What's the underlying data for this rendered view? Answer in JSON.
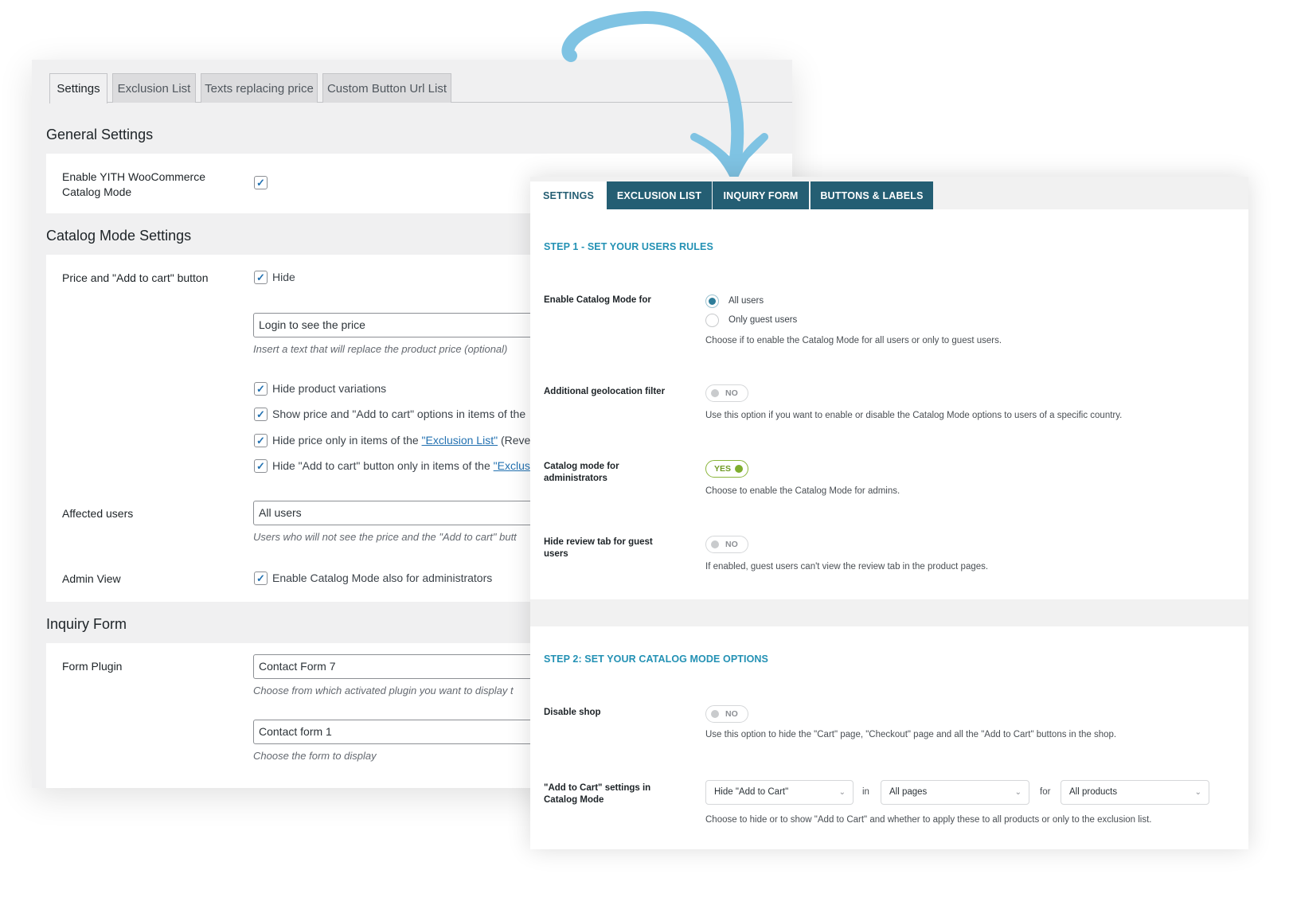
{
  "old_panel": {
    "tabs": [
      "Settings",
      "Exclusion List",
      "Texts replacing price",
      "Custom Button Url List"
    ],
    "general": {
      "title": "General Settings",
      "enable_label": "Enable YITH WooCommerce Catalog Mode"
    },
    "catalog": {
      "title": "Catalog Mode Settings",
      "price_label": "Price and \"Add to cart\" button",
      "hide_label": "Hide",
      "price_text_value": "Login to see the price",
      "price_text_desc": "Insert a text that will replace the product price (optional)",
      "hide_variations": "Hide product variations",
      "show_price_text": "Show price and \"Add to cart\" options in items of the",
      "hide_price_only_pre": "Hide price only in items of the ",
      "hide_price_only_link": "\"Exclusion List\"",
      "hide_price_only_post": " (Rever",
      "hide_cart_only_pre": "Hide \"Add to cart\" button only in items of the ",
      "hide_cart_only_link": "\"Exclus",
      "affected_label": "Affected users",
      "affected_value": "All users",
      "affected_desc": "Users who will not see the price and the \"Add to cart\" butt",
      "admin_label": "Admin View",
      "admin_checkbox": "Enable Catalog Mode also for administrators"
    },
    "inquiry": {
      "title": "Inquiry Form",
      "plugin_label": "Form Plugin",
      "plugin_value": "Contact Form 7",
      "plugin_desc": "Choose from which activated plugin you want to display t",
      "form_value": "Contact form 1",
      "form_desc": "Choose the form to display"
    }
  },
  "new_panel": {
    "tabs": [
      "SETTINGS",
      "EXCLUSION LIST",
      "INQUIRY FORM",
      "BUTTONS & LABELS"
    ],
    "step1": {
      "title": "STEP 1 - SET YOUR USERS RULES",
      "enable_for_label": "Enable Catalog Mode for",
      "radio_all": "All users",
      "radio_guest": "Only guest users",
      "enable_for_desc": "Choose if to enable the Catalog Mode for all users or only to guest users.",
      "geo_label": "Additional geolocation filter",
      "geo_toggle": "NO",
      "geo_desc": "Use this option if you want to enable or disable the Catalog Mode options to users of a specific country.",
      "admins_label": "Catalog mode for administrators",
      "admins_toggle": "YES",
      "admins_desc": "Choose to enable the Catalog Mode for admins.",
      "review_label": "Hide review tab for guest users",
      "review_toggle": "NO",
      "review_desc": "If enabled, guest users can't view the review tab in the product pages."
    },
    "step2": {
      "title": "STEP 2: SET YOUR CATALOG MODE OPTIONS",
      "disable_shop_label": "Disable shop",
      "disable_shop_toggle": "NO",
      "disable_shop_desc": "Use this option to hide the \"Cart\" page, \"Checkout\" page and all the \"Add to Cart\" buttons in the shop.",
      "atc_label": "\"Add to Cart\" settings in Catalog Mode",
      "atc_select_1": "Hide \"Add to Cart\"",
      "atc_in": "in",
      "atc_select_2": "All pages",
      "atc_for": "for",
      "atc_select_3": "All products",
      "atc_desc": "Choose to hide or to show \"Add to Cart\" and whether to apply these to all products or only to the exclusion list."
    }
  },
  "colors": {
    "new_tab_bg": "#245e73",
    "step_title": "#2391b4",
    "arrow": "#7fc3e3",
    "toggle_on": "#7fae2e"
  }
}
